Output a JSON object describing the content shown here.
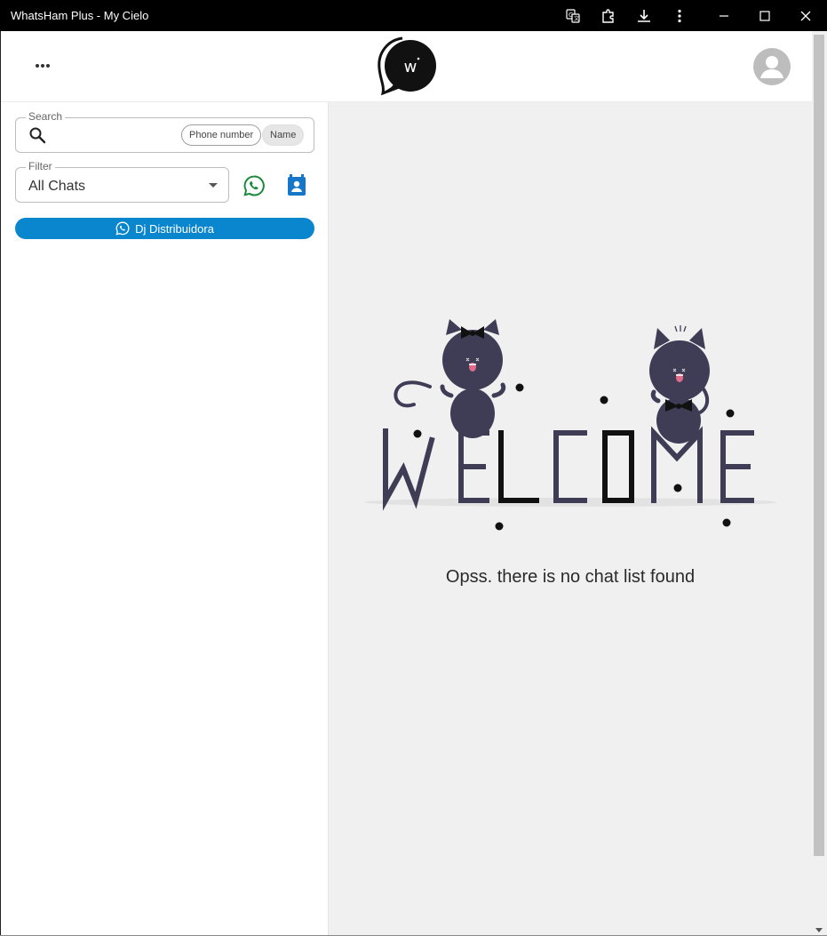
{
  "window": {
    "title": "WhatsHam Plus - My Cielo"
  },
  "header": {
    "logo_letter": "w",
    "menu_icon": "more-horizontal-icon",
    "avatar_icon": "account-icon"
  },
  "sidebar": {
    "search": {
      "label": "Search",
      "placeholder": "",
      "chips": [
        "Phone number",
        "Name"
      ]
    },
    "filter": {
      "label": "Filter",
      "value": "All Chats"
    },
    "account_button": {
      "label": "Dj Distribuidora"
    }
  },
  "main": {
    "welcome_text": "WELCOME",
    "empty_message": "Opss. there is no chat list found"
  },
  "colors": {
    "accent_blue": "#0a86cf",
    "whatsapp_green": "#1b8a3c",
    "contact_blue": "#1677c9",
    "cat_color": "#3f3d56"
  }
}
